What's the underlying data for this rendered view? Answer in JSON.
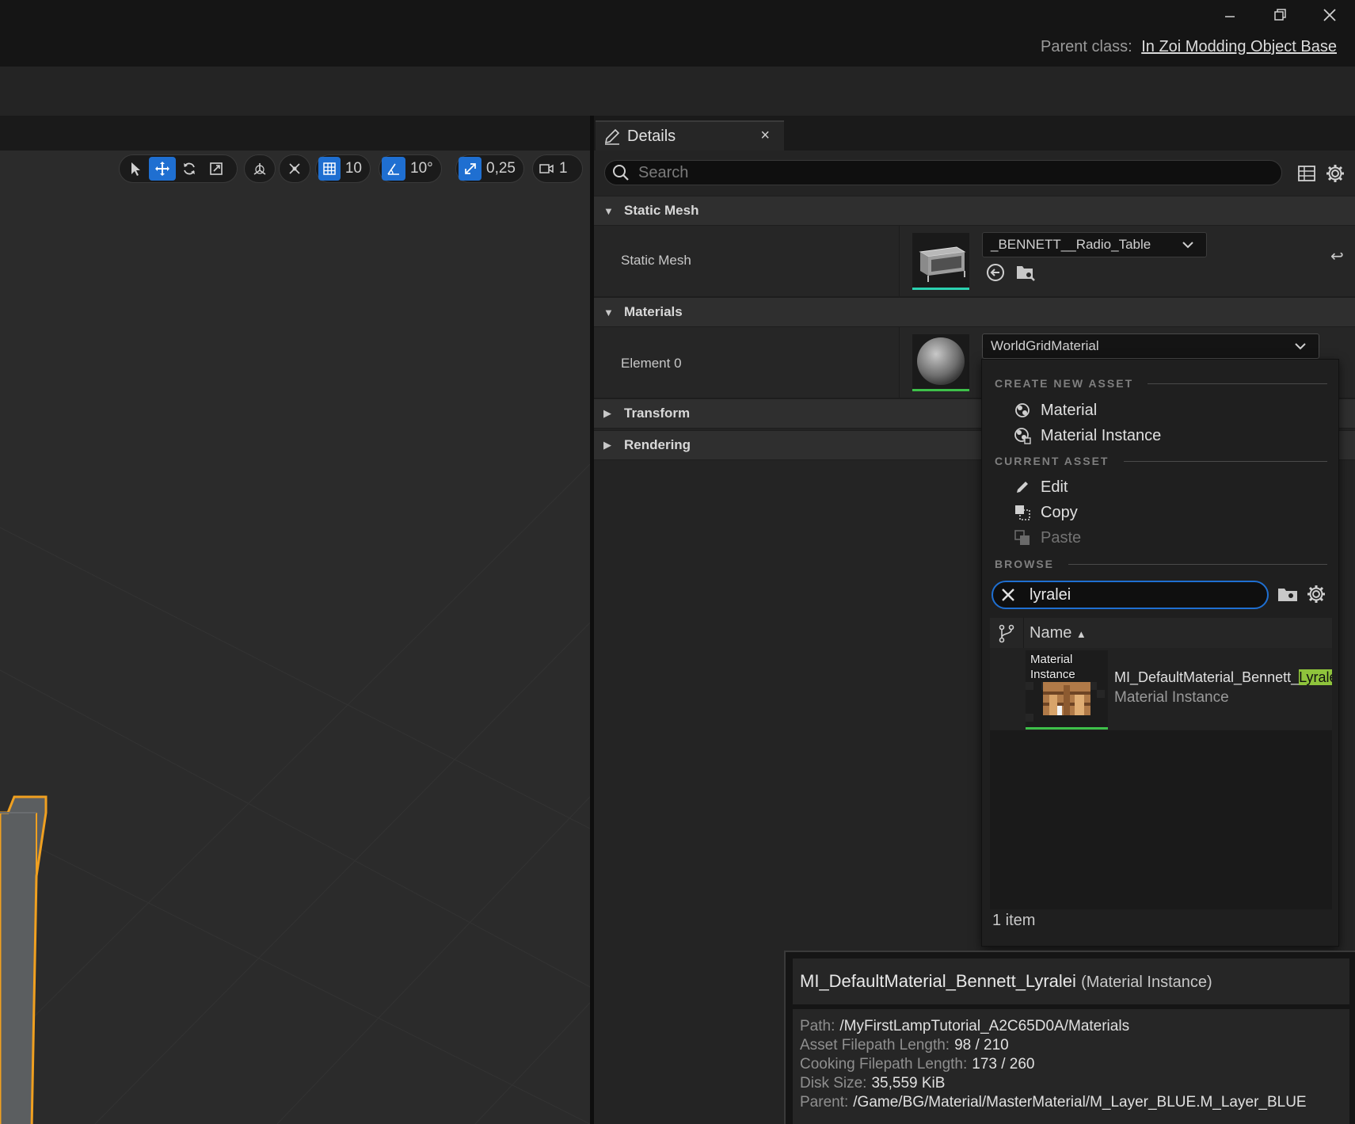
{
  "window": {
    "parent_class_label": "Parent class:",
    "parent_class_value": "In Zoi Modding Object Base"
  },
  "toolbar": {
    "grid_snap": "10",
    "rotation_snap": "10°",
    "scale_snap": "0,25",
    "camera_speed": "1"
  },
  "details": {
    "tab_label": "Details",
    "search_placeholder": "Search",
    "sections": {
      "static_mesh": "Static Mesh",
      "materials": "Materials",
      "transform": "Transform",
      "rendering": "Rendering"
    },
    "static_mesh_row": {
      "label": "Static Mesh",
      "value": "_BENNETT__Radio_Table"
    },
    "element0_row": {
      "label": "Element 0",
      "value": "WorldGridMaterial"
    }
  },
  "menu": {
    "create_heading": "CREATE NEW ASSET",
    "create_items": [
      "Material",
      "Material Instance"
    ],
    "current_heading": "CURRENT ASSET",
    "current_items": [
      "Edit",
      "Copy",
      "Paste"
    ],
    "browse_heading": "BROWSE",
    "browse_search_value": "lyralei",
    "column_name": "Name",
    "asset": {
      "thumb_type_line1": "Material",
      "thumb_type_line2": "Instance",
      "name_prefix": "MI_DefaultMaterial_Bennett_",
      "name_highlight": "Lyrale",
      "type": "Material Instance"
    },
    "item_count": "1 item"
  },
  "tooltip": {
    "title": "MI_DefaultMaterial_Bennett_Lyralei",
    "type": "(Material Instance)",
    "rows": [
      {
        "k": "Path:",
        "v": "/MyFirstLampTutorial_A2C65D0A/Materials"
      },
      {
        "k": "Asset Filepath Length:",
        "v": "98 / 210"
      },
      {
        "k": "Cooking Filepath Length:",
        "v": "173 / 260"
      },
      {
        "k": "Disk Size:",
        "v": "35,559 KiB"
      },
      {
        "k": "Parent:",
        "v": "/Game/BG/Material/MasterMaterial/M_Layer_BLUE.M_Layer_BLUE"
      }
    ]
  },
  "colors": {
    "accent_blue": "#1f6fd1",
    "highlight_green": "#8fc43c",
    "selection_orange": "#f0a020"
  }
}
